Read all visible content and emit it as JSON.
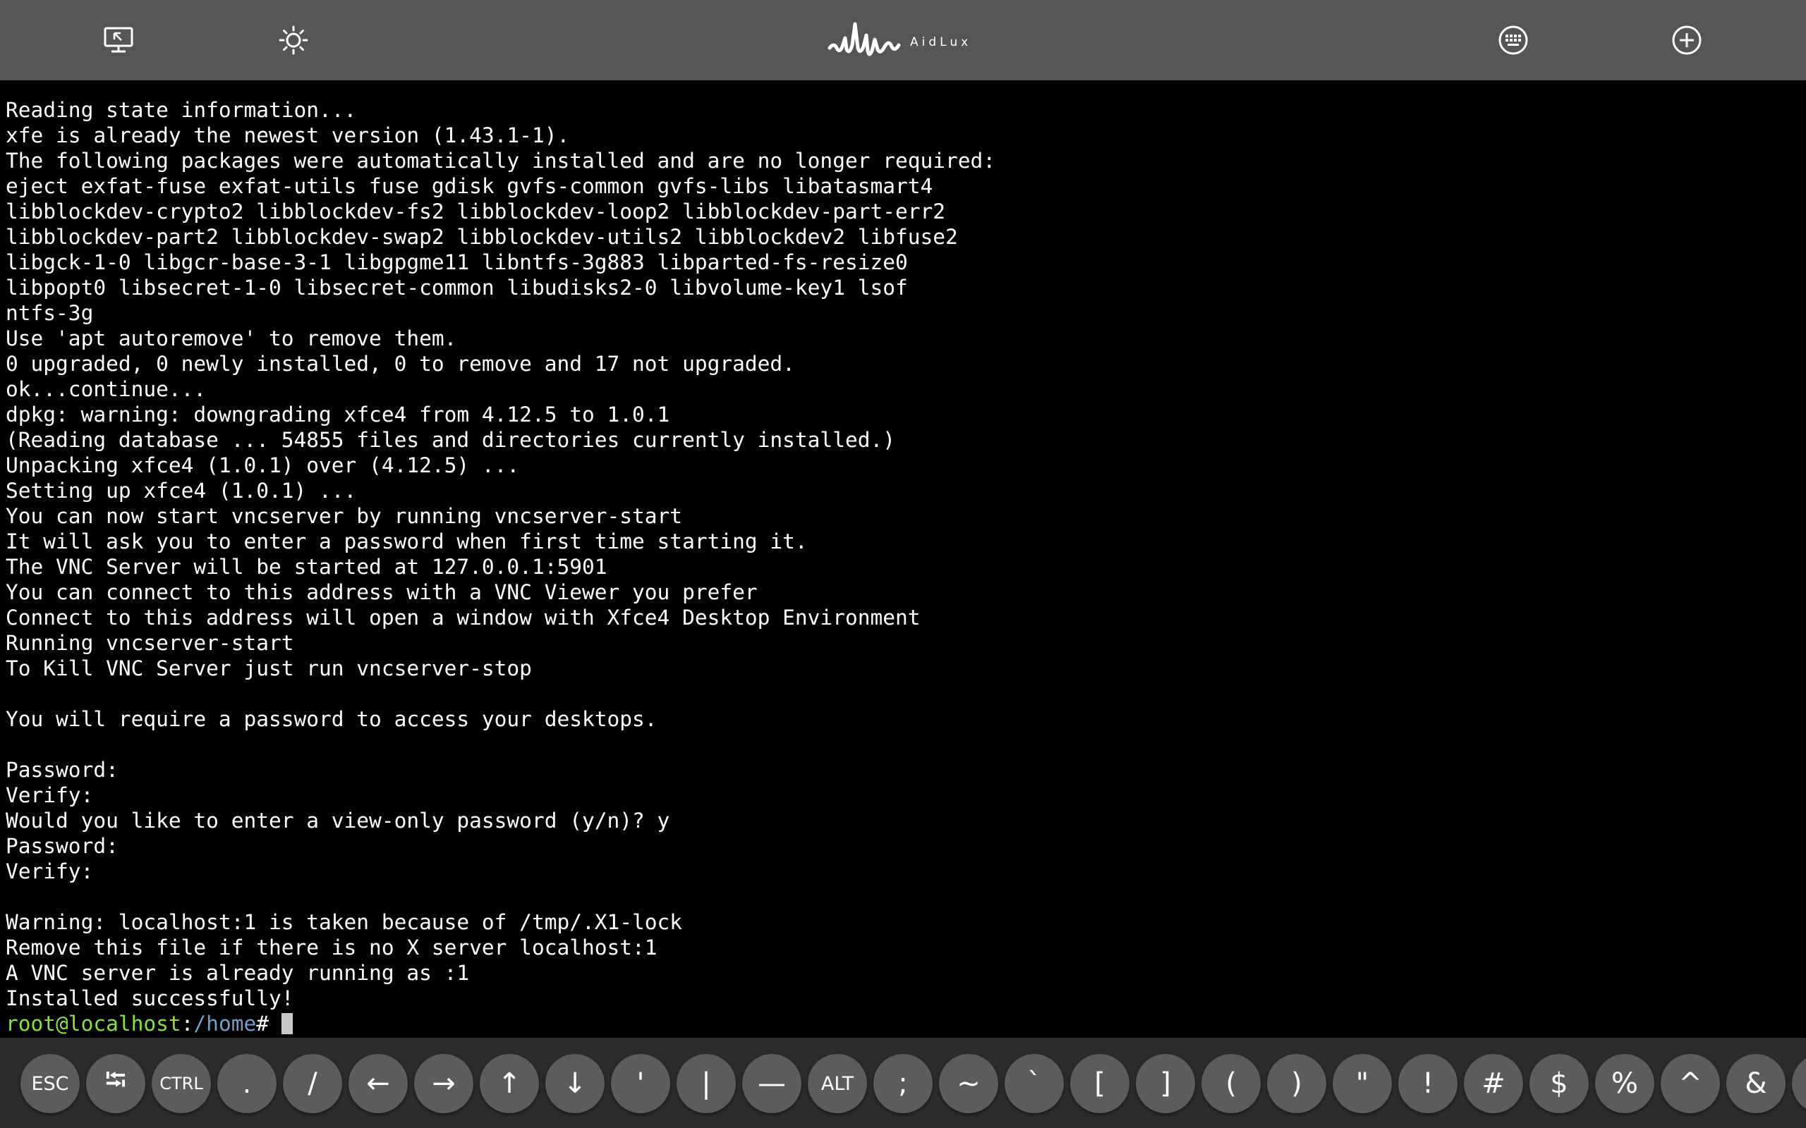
{
  "topbar": {
    "brand": "AidLux",
    "icons": {
      "left1": "screen-cursor-icon",
      "left2": "brightness-icon",
      "right1": "keyboard-icon",
      "right2": "add-circle-icon"
    }
  },
  "terminal": {
    "lines": [
      "Reading state information...",
      "xfe is already the newest version (1.43.1-1).",
      "The following packages were automatically installed and are no longer required:",
      "eject exfat-fuse exfat-utils fuse gdisk gvfs-common gvfs-libs libatasmart4",
      "libblockdev-crypto2 libblockdev-fs2 libblockdev-loop2 libblockdev-part-err2",
      "libblockdev-part2 libblockdev-swap2 libblockdev-utils2 libblockdev2 libfuse2",
      "libgck-1-0 libgcr-base-3-1 libgpgme11 libntfs-3g883 libparted-fs-resize0",
      "libpopt0 libsecret-1-0 libsecret-common libudisks2-0 libvolume-key1 lsof",
      "ntfs-3g",
      "Use 'apt autoremove' to remove them.",
      "0 upgraded, 0 newly installed, 0 to remove and 17 not upgraded.",
      "ok...continue...",
      "dpkg: warning: downgrading xfce4 from 4.12.5 to 1.0.1",
      "(Reading database ... 54855 files and directories currently installed.)",
      "Unpacking xfce4 (1.0.1) over (4.12.5) ...",
      "Setting up xfce4 (1.0.1) ...",
      "You can now start vncserver by running vncserver-start",
      "It will ask you to enter a password when first time starting it.",
      "The VNC Server will be started at 127.0.0.1:5901",
      "You can connect to this address with a VNC Viewer you prefer",
      "Connect to this address will open a window with Xfce4 Desktop Environment",
      "Running vncserver-start",
      "To Kill VNC Server just run vncserver-stop",
      "",
      "You will require a password to access your desktops.",
      "",
      "Password:",
      "Verify:",
      "Would you like to enter a view-only password (y/n)? y",
      "Password:",
      "Verify:",
      "",
      "Warning: localhost:1 is taken because of /tmp/.X1-lock",
      "Remove this file if there is no X server localhost:1",
      "A VNC server is already running as :1",
      "Installed successfully!"
    ],
    "prompt": {
      "user": "root@localhost",
      "sep": ":",
      "path": "/home",
      "hash": "#"
    }
  },
  "keys": [
    {
      "label": "ESC",
      "name": "key-esc"
    },
    {
      "label": "⭾",
      "name": "key-tab"
    },
    {
      "label": "CTRL",
      "name": "key-ctrl"
    },
    {
      "label": ".",
      "name": "key-period"
    },
    {
      "label": "/",
      "name": "key-slash"
    },
    {
      "label": "←",
      "name": "key-left-arrow"
    },
    {
      "label": "→",
      "name": "key-right-arrow"
    },
    {
      "label": "↑",
      "name": "key-up-arrow"
    },
    {
      "label": "↓",
      "name": "key-down-arrow"
    },
    {
      "label": "'",
      "name": "key-single-quote"
    },
    {
      "label": "|",
      "name": "key-pipe"
    },
    {
      "label": "—",
      "name": "key-dash"
    },
    {
      "label": "ALT",
      "name": "key-alt"
    },
    {
      "label": ";",
      "name": "key-semicolon"
    },
    {
      "label": "~",
      "name": "key-tilde"
    },
    {
      "label": "`",
      "name": "key-backtick"
    },
    {
      "label": "[",
      "name": "key-left-bracket"
    },
    {
      "label": "]",
      "name": "key-right-bracket"
    },
    {
      "label": "(",
      "name": "key-left-paren"
    },
    {
      "label": ")",
      "name": "key-right-paren"
    },
    {
      "label": "\"",
      "name": "key-double-quote"
    },
    {
      "label": "!",
      "name": "key-exclamation"
    },
    {
      "label": "#",
      "name": "key-hash"
    },
    {
      "label": "$",
      "name": "key-dollar"
    },
    {
      "label": "%",
      "name": "key-percent"
    },
    {
      "label": "^",
      "name": "key-caret"
    },
    {
      "label": "&",
      "name": "key-ampersand"
    },
    {
      "label": "*",
      "name": "key-asterisk"
    }
  ]
}
